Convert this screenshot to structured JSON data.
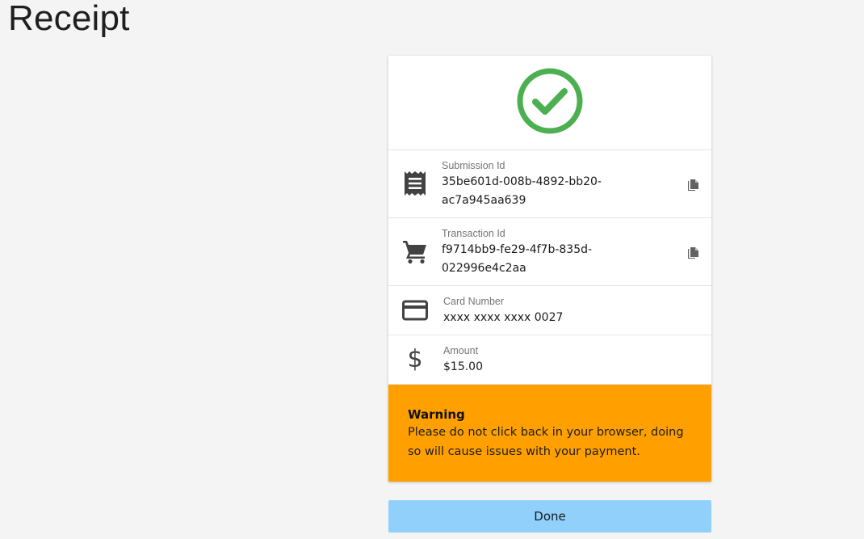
{
  "page": {
    "title": "Receipt"
  },
  "receipt": {
    "status_icon": "check-circle-icon",
    "status_color": "#4caf50",
    "rows": [
      {
        "icon": "receipt-icon",
        "label": "Submission Id",
        "value_line1": "35be601d-008b-4892-bb20-",
        "value_line2": "ac7a945aa639",
        "copy_icon": "copy-icon"
      },
      {
        "icon": "cart-icon",
        "label": "Transaction Id",
        "value_line1": "f9714bb9-fe29-4f7b-835d-",
        "value_line2": "022996e4c2aa",
        "copy_icon": "copy-icon"
      },
      {
        "icon": "credit-card-icon",
        "label": "Card Number",
        "value": "xxxx xxxx xxxx 0027"
      },
      {
        "icon": "dollar-icon",
        "label": "Amount",
        "value": "$15.00"
      }
    ]
  },
  "warning": {
    "title": "Warning",
    "line1": "Please do not click back in your browser, doing",
    "line2": "so will cause issues with your payment.",
    "color": "#ffa000"
  },
  "actions": {
    "done_label": "Done",
    "done_color": "#90d0fb"
  }
}
